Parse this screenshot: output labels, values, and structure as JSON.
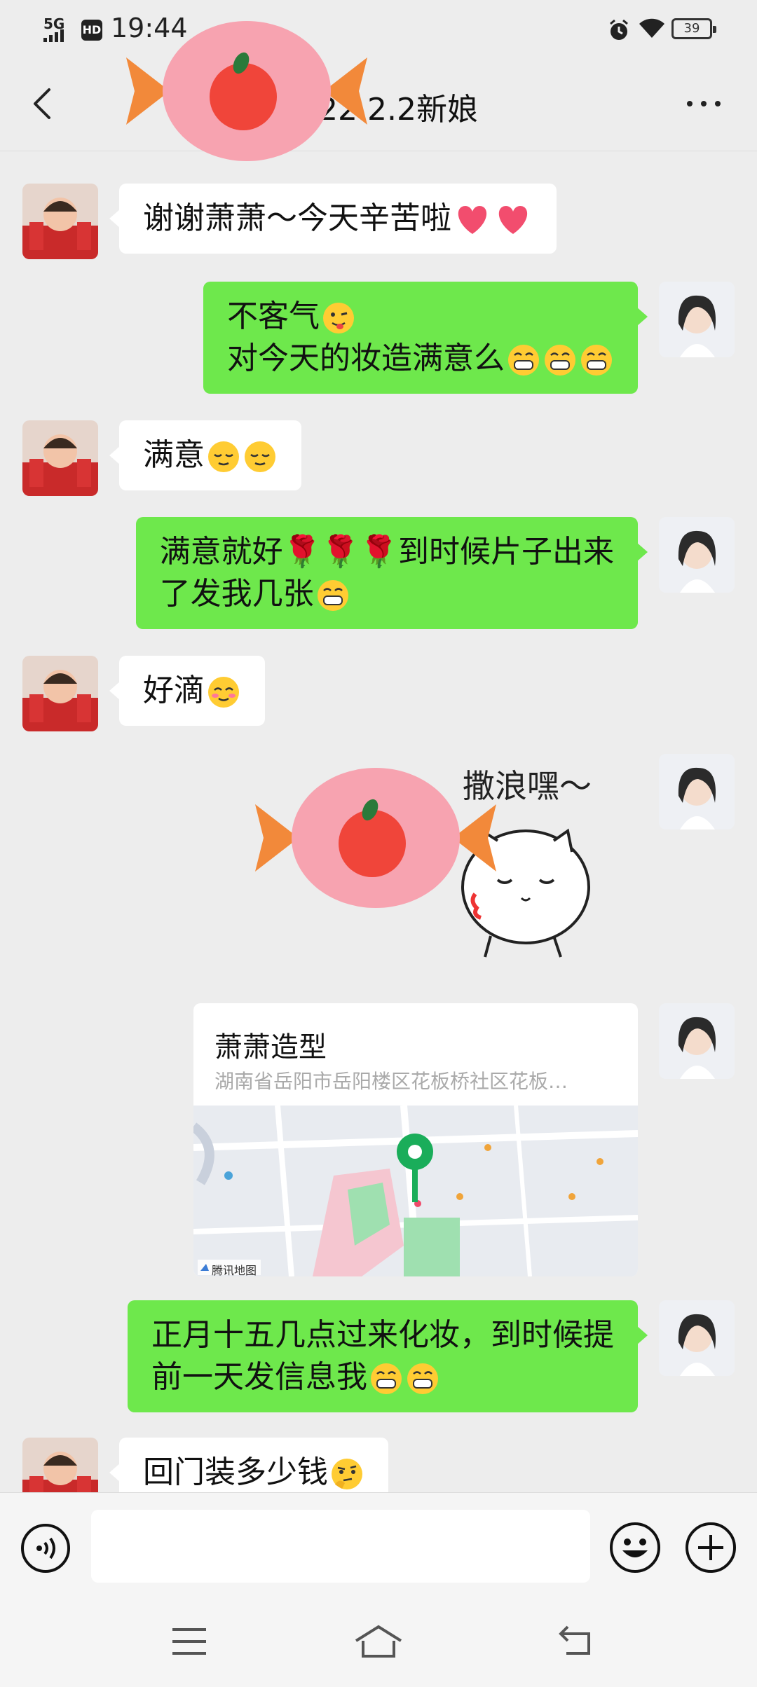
{
  "status_bar": {
    "network": "5G",
    "hd": "HD",
    "time": "19:44",
    "battery": "39"
  },
  "header": {
    "title": "2022.2.2新娘",
    "more_icon": "more-dots-icon",
    "back_icon": "back-chevron-icon"
  },
  "messages": [
    {
      "side": "left",
      "lines": [
        "谢谢萧萧～今天辛苦啦"
      ],
      "emoji": "two-pink-hearts"
    },
    {
      "side": "right",
      "lines": [
        "不客气",
        "对今天的妆造满意么"
      ],
      "emoji": "wink-tongue, grin x3"
    },
    {
      "side": "left",
      "lines": [
        "满意"
      ],
      "emoji": "relieved x2"
    },
    {
      "side": "right",
      "lines": [
        "满意就好🌹🌹🌹到时候片子出来",
        "了发我几张"
      ],
      "emoji": "grin"
    },
    {
      "side": "left",
      "lines": [
        "好滴"
      ],
      "emoji": "blush"
    },
    {
      "side": "right",
      "type": "sticker",
      "sticker_text": "撒浪嘿～"
    },
    {
      "side": "right",
      "type": "location",
      "name": "萧萧造型",
      "address": "湖南省岳阳市岳阳楼区花板桥社区花板…",
      "map_brand": "腾讯地图"
    },
    {
      "side": "right",
      "lines": [
        "正月十五几点过来化妆，到时候提",
        "前一天发信息我"
      ],
      "emoji": "grin x2"
    },
    {
      "side": "left",
      "lines": [
        "回门装多少钱"
      ],
      "emoji": "thinking"
    }
  ],
  "input": {
    "value": "",
    "placeholder": ""
  },
  "colors": {
    "bg": "#ededed",
    "sent_bubble": "#6ee84c",
    "recv_bubble": "#ffffff",
    "candy_pink": "#f7a3b0",
    "candy_orange": "#f2893a"
  }
}
